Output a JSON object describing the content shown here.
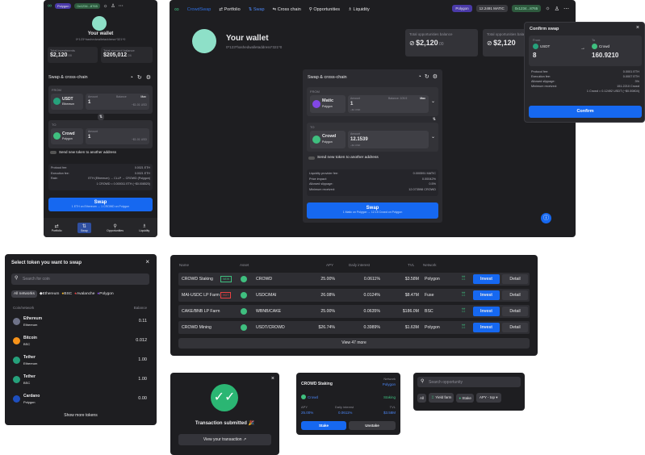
{
  "brand": {
    "name": "CrowdSwap"
  },
  "header": {
    "nav": [
      "Portfolio",
      "Swap",
      "Cross chain",
      "Opportunities",
      "Liquidity"
    ],
    "network": "Polygon",
    "balance": "12.2491 MATIC",
    "address": "0x1234...8765"
  },
  "wallet": {
    "title": "Your wallet",
    "address": "0*123*hashedwalletaddress*321*0",
    "total_investments_label": "Total investments",
    "total_investments": "$2,120",
    "total_investments_dec": ".00",
    "total_opp_label": "Total opportunities balance",
    "total_opp": "$2,120",
    "total_opp_dec": ".00",
    "total_account_label": "Total account balance",
    "total_account": "$205,012",
    "total_account_dec": ".24"
  },
  "swap": {
    "title": "Swap & cross-chain",
    "from_label": "FROM",
    "to_label": "TO",
    "amount_label": "Amount",
    "balance_label": "Balance",
    "max_label": "Max",
    "mobile_from_token": "USDT",
    "mobile_from_network": "Ethereum",
    "mobile_from_amount": "1",
    "mobile_from_usd": "~$1.01 USD",
    "mobile_to_token": "Crowd",
    "mobile_to_network": "Polygon",
    "mobile_to_amount": "1",
    "mobile_to_usd": "~$1.01 USD",
    "desktop_from_token": "Matic",
    "desktop_from_network": "Polygon",
    "desktop_from_amount": "1",
    "desktop_from_balance": "Balance: 105.5",
    "desktop_from_usd": "~$1 USD",
    "desktop_to_token": "Crowd",
    "desktop_to_network": "Polygon",
    "desktop_to_amount": "12.1539",
    "desktop_to_usd": "~$1 USD",
    "send_label": "Send new token to another address",
    "mobile_details": [
      {
        "k": "Protocol fee:",
        "v": "0.0021 ETH"
      },
      {
        "k": "Execution fee:",
        "v": "0.0021 ETH"
      },
      {
        "k": "Rate:",
        "v": "ETH (Ethereum) → CLLP → CROWD (Polygon)"
      },
      {
        "k": "",
        "v": "1 CROWD = 0.000011 ETH (~$0.008520)"
      }
    ],
    "desktop_details": [
      {
        "k": "Liquidity provider fee:",
        "v": "0.000591 MATIC"
      },
      {
        "k": "Price impact:",
        "v": "0.00042%"
      },
      {
        "k": "Allowed slippage:",
        "v": "0.5%"
      },
      {
        "k": "Minimum received:",
        "v": "12.073598 CROWD"
      }
    ],
    "swap_btn": "Swap",
    "mobile_swap_sub": "1 ETH on Ethereum → 1 CROWD on Polygon",
    "desktop_swap_sub": "1 Matic on Polygon → 12.15 Crowd on Polygon"
  },
  "bottom_nav": [
    "Portfolio",
    "Swap",
    "Opportunities",
    "Liquidity"
  ],
  "confirm": {
    "title": "Confirm swap",
    "from": "From",
    "to": "To",
    "from_token": "USDT",
    "from_amount": "8",
    "to_token": "Crowd",
    "to_amount": "160.9210",
    "rows": [
      {
        "k": "Protocol fee:",
        "v": "0.0001 ETH"
      },
      {
        "k": "Execution fee:",
        "v": "0.0007 ETH"
      },
      {
        "k": "Allowed slippage:",
        "v": "3%"
      },
      {
        "k": "Minimum received:",
        "v": "151.2210 Crowd"
      },
      {
        "k": "",
        "v": "1 Crowd = 0.12492 USDT (~$0.00804)"
      }
    ],
    "button": "Confirm"
  },
  "token_select": {
    "title": "Select token you want to swap",
    "search_placeholder": "Search for coin",
    "filters": [
      "All networks",
      "Ethereum",
      "BSC",
      "Avalanche",
      "Polygon"
    ],
    "col_coin": "Coin/network",
    "col_balance": "Balance",
    "tokens": [
      {
        "name": "Ethereum",
        "net": "Ethereum",
        "bal": "0.11",
        "color": "#6f7388"
      },
      {
        "name": "Bitcoin",
        "net": "BSC",
        "bal": "0.012",
        "color": "#f7931a"
      },
      {
        "name": "Tether",
        "net": "Ethereum",
        "bal": "1.00",
        "color": "#26a17b"
      },
      {
        "name": "Tether",
        "net": "BSC",
        "bal": "1.00",
        "color": "#26a17b"
      },
      {
        "name": "Cardano",
        "net": "Polygon",
        "bal": "0.00",
        "color": "#1e4fbf"
      }
    ],
    "show_more": "Show more tokens"
  },
  "opps_table": {
    "headers": [
      "Name",
      "Asset",
      "APY",
      "Daily interest",
      "TVL",
      "Network"
    ],
    "rows": [
      {
        "name": "CROWD Staking",
        "tag": "NEW",
        "asset": "CROWD",
        "apy": "25.00%",
        "daily": "0.0611%",
        "tvl": "$3.58M",
        "net": "Polygon"
      },
      {
        "name": "MAI-USDC LP Farm",
        "tag": "HOT",
        "asset": "USDC/MAI",
        "apy": "26.08%",
        "daily": "0.0124%",
        "tvl": "$8.47M",
        "net": "Fuse"
      },
      {
        "name": "CAKE/BNB LP Farm",
        "tag": "",
        "asset": "WBNB/CAKE",
        "apy": "25.00%",
        "daily": "0.0635%",
        "tvl": "$186.0M",
        "net": "BSC"
      },
      {
        "name": "CROWD Mining",
        "tag": "",
        "asset": "USDT/CROWD",
        "apy": "$26.74%",
        "daily": "0.3989%",
        "tvl": "$1.63M",
        "net": "Polygon"
      }
    ],
    "invest": "Invest",
    "detail": "Detail",
    "view_more": "View 47 more"
  },
  "tx": {
    "title": "Transaction submitted 🎉",
    "button": "View your transaction"
  },
  "stake_card": {
    "title": "CROWD Staking",
    "network_label": "Network",
    "network": "Polygon",
    "asset": "Crowd",
    "status": "Staking",
    "apy_label": "APY",
    "daily_label": "Daily interest",
    "tvl_label": "TVL",
    "apy": "25.00%",
    "daily": "0.0611%",
    "tvl": "$3.58M",
    "stake": "Stake",
    "unstake": "Unstake"
  },
  "opp_filter": {
    "search_placeholder": "Search opportunity",
    "chips": [
      "All",
      "Yield farm",
      "Stake"
    ],
    "sort": "APY - top"
  },
  "colors": {
    "accent": "#1668f0",
    "bg": "#1e1e21",
    "panel": "#2a2a2e",
    "green": "#3fbf7f"
  }
}
